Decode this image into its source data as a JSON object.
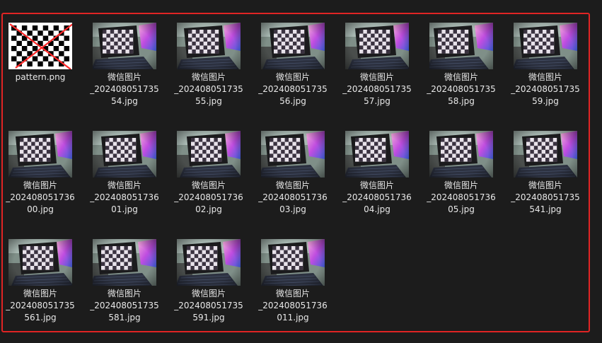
{
  "highlight_color": "#e02424",
  "files": [
    {
      "name_lines": [
        "pattern.png"
      ],
      "thumbnail": "checkerboard-crossed-out",
      "crossed_out": true
    },
    {
      "name_lines": [
        "微信图片",
        "_202408051735",
        "54.jpg"
      ],
      "thumbnail": "camera-photo"
    },
    {
      "name_lines": [
        "微信图片",
        "_202408051735",
        "55.jpg"
      ],
      "thumbnail": "camera-photo"
    },
    {
      "name_lines": [
        "微信图片",
        "_202408051735",
        "56.jpg"
      ],
      "thumbnail": "camera-photo"
    },
    {
      "name_lines": [
        "微信图片",
        "_202408051735",
        "57.jpg"
      ],
      "thumbnail": "camera-photo"
    },
    {
      "name_lines": [
        "微信图片",
        "_202408051735",
        "58.jpg"
      ],
      "thumbnail": "camera-photo"
    },
    {
      "name_lines": [
        "微信图片",
        "_202408051735",
        "59.jpg"
      ],
      "thumbnail": "camera-photo"
    },
    {
      "name_lines": [
        "微信图片",
        "_202408051736",
        "00.jpg"
      ],
      "thumbnail": "camera-photo"
    },
    {
      "name_lines": [
        "微信图片",
        "_202408051736",
        "01.jpg"
      ],
      "thumbnail": "camera-photo"
    },
    {
      "name_lines": [
        "微信图片",
        "_202408051736",
        "02.jpg"
      ],
      "thumbnail": "camera-photo"
    },
    {
      "name_lines": [
        "微信图片",
        "_202408051736",
        "03.jpg"
      ],
      "thumbnail": "camera-photo"
    },
    {
      "name_lines": [
        "微信图片",
        "_202408051736",
        "04.jpg"
      ],
      "thumbnail": "camera-photo"
    },
    {
      "name_lines": [
        "微信图片",
        "_202408051736",
        "05.jpg"
      ],
      "thumbnail": "camera-photo"
    },
    {
      "name_lines": [
        "微信图片",
        "_202408051735",
        "541.jpg"
      ],
      "thumbnail": "camera-photo"
    },
    {
      "name_lines": [
        "微信图片",
        "_202408051735",
        "561.jpg"
      ],
      "thumbnail": "camera-photo"
    },
    {
      "name_lines": [
        "微信图片",
        "_202408051735",
        "581.jpg"
      ],
      "thumbnail": "camera-photo"
    },
    {
      "name_lines": [
        "微信图片",
        "_202408051735",
        "591.jpg"
      ],
      "thumbnail": "camera-photo"
    },
    {
      "name_lines": [
        "微信图片",
        "_202408051736",
        "011.jpg"
      ],
      "thumbnail": "camera-photo"
    }
  ]
}
